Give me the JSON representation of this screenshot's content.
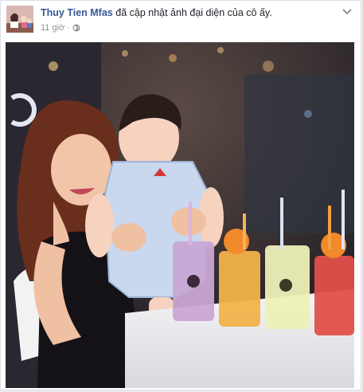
{
  "post": {
    "author": "Thuy Tien Mfas",
    "action": "đã cập nhật ảnh đại diện của cô ấy.",
    "time": "11 giờ",
    "audience_icon": "globe-icon",
    "options_icon": "chevron-down-icon"
  },
  "colors": {
    "author_link": "#365899",
    "meta_text": "#90949c",
    "card_border": "#dddfe2"
  }
}
